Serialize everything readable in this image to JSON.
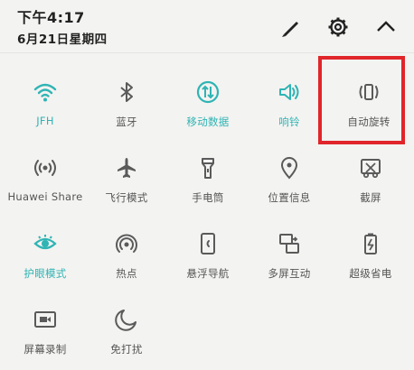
{
  "status": {
    "time": "下午4:17",
    "date": "6月21日星期四"
  },
  "header": {
    "edit_icon": "pencil-icon",
    "settings_icon": "gear-icon",
    "collapse_icon": "chevron-up-icon"
  },
  "colors": {
    "active": "#2fb4b4",
    "inactive": "#5a5a5a",
    "highlight": "#e0262a"
  },
  "tiles": [
    {
      "label": "JFH",
      "icon": "wifi-icon",
      "active": true
    },
    {
      "label": "蓝牙",
      "icon": "bluetooth-icon",
      "active": false
    },
    {
      "label": "移动数据",
      "icon": "mobile-data-icon",
      "active": true
    },
    {
      "label": "响铃",
      "icon": "speaker-icon",
      "active": true
    },
    {
      "label": "自动旋转",
      "icon": "auto-rotate-icon",
      "active": false
    },
    {
      "label": "Huawei Share",
      "icon": "huawei-share-icon",
      "active": false
    },
    {
      "label": "飞行模式",
      "icon": "airplane-icon",
      "active": false
    },
    {
      "label": "手电筒",
      "icon": "flashlight-icon",
      "active": false
    },
    {
      "label": "位置信息",
      "icon": "location-icon",
      "active": false
    },
    {
      "label": "截屏",
      "icon": "screenshot-icon",
      "active": false
    },
    {
      "label": "护眼模式",
      "icon": "eye-icon",
      "active": true
    },
    {
      "label": "热点",
      "icon": "hotspot-icon",
      "active": false
    },
    {
      "label": "悬浮导航",
      "icon": "floating-nav-icon",
      "active": false
    },
    {
      "label": "多屏互动",
      "icon": "multi-screen-icon",
      "active": false
    },
    {
      "label": "超级省电",
      "icon": "battery-saver-icon",
      "active": false
    },
    {
      "label": "屏幕录制",
      "icon": "screen-record-icon",
      "active": false
    },
    {
      "label": "免打扰",
      "icon": "moon-icon",
      "active": false
    }
  ]
}
